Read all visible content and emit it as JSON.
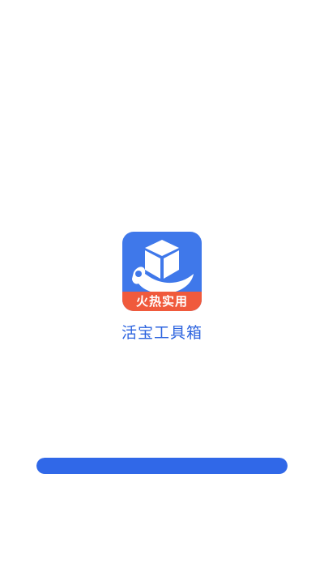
{
  "app": {
    "name": "活宝工具箱",
    "icon_badge": "火热实用"
  },
  "loading": {
    "progress": 1.0
  },
  "colors": {
    "background": "#ffffff",
    "icon_background": "#3f78ea",
    "badge_background": "#f05a3c",
    "app_name_text": "#2d64df",
    "progress_bar": "#3068e8"
  },
  "icons": {
    "logo": "box-wrench-icon"
  }
}
